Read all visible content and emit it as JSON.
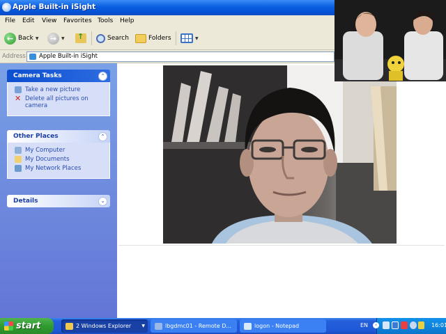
{
  "window": {
    "title": "Apple Built-in iSight"
  },
  "menu": [
    "File",
    "Edit",
    "View",
    "Favorites",
    "Tools",
    "Help"
  ],
  "toolbar": {
    "back": "Back",
    "search": "Search",
    "folders": "Folders"
  },
  "address": {
    "label": "Address",
    "value": "Apple Built-in iSight"
  },
  "camera_tasks": {
    "title": "Camera Tasks",
    "items": [
      "Take a new picture",
      "Delete all pictures on camera"
    ]
  },
  "other_places": {
    "title": "Other Places",
    "items": [
      "My Computer",
      "My Documents",
      "My Network Places"
    ]
  },
  "details": {
    "title": "Details"
  },
  "taskbar": {
    "start": "start",
    "tasks": [
      "2 Windows Explorer",
      "lbgdmc01 - Remote D...",
      "logon - Notepad"
    ],
    "lang": "EN",
    "clock": "16:01"
  },
  "colors": {
    "xp_blue": "#0a5ee0",
    "task_pane": "#6375d6",
    "start_green": "#2f9c2f"
  }
}
